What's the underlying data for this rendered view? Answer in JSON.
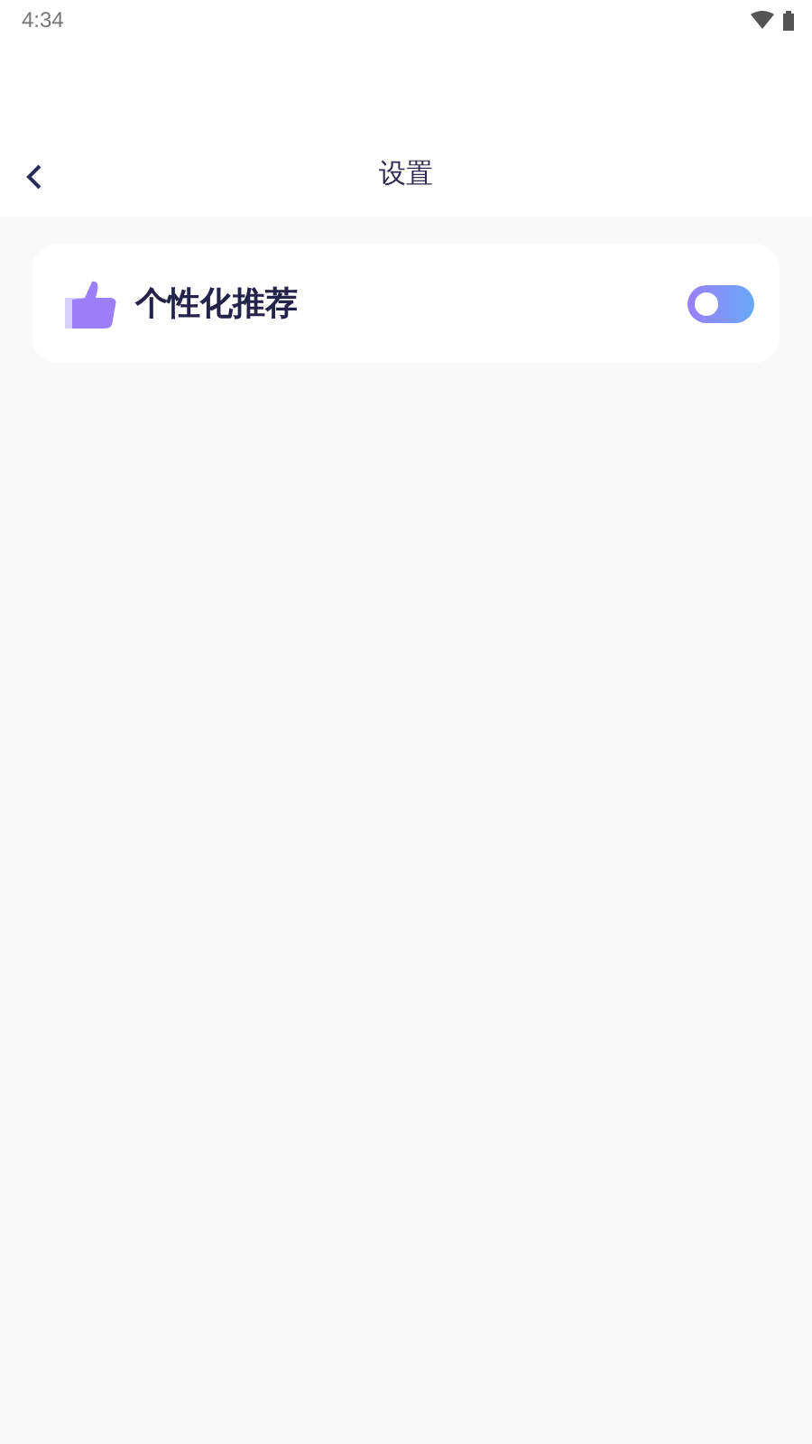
{
  "status_bar": {
    "time": "4:34"
  },
  "header": {
    "title": "设置"
  },
  "settings": [
    {
      "label": "个性化推荐",
      "on": false
    }
  ]
}
